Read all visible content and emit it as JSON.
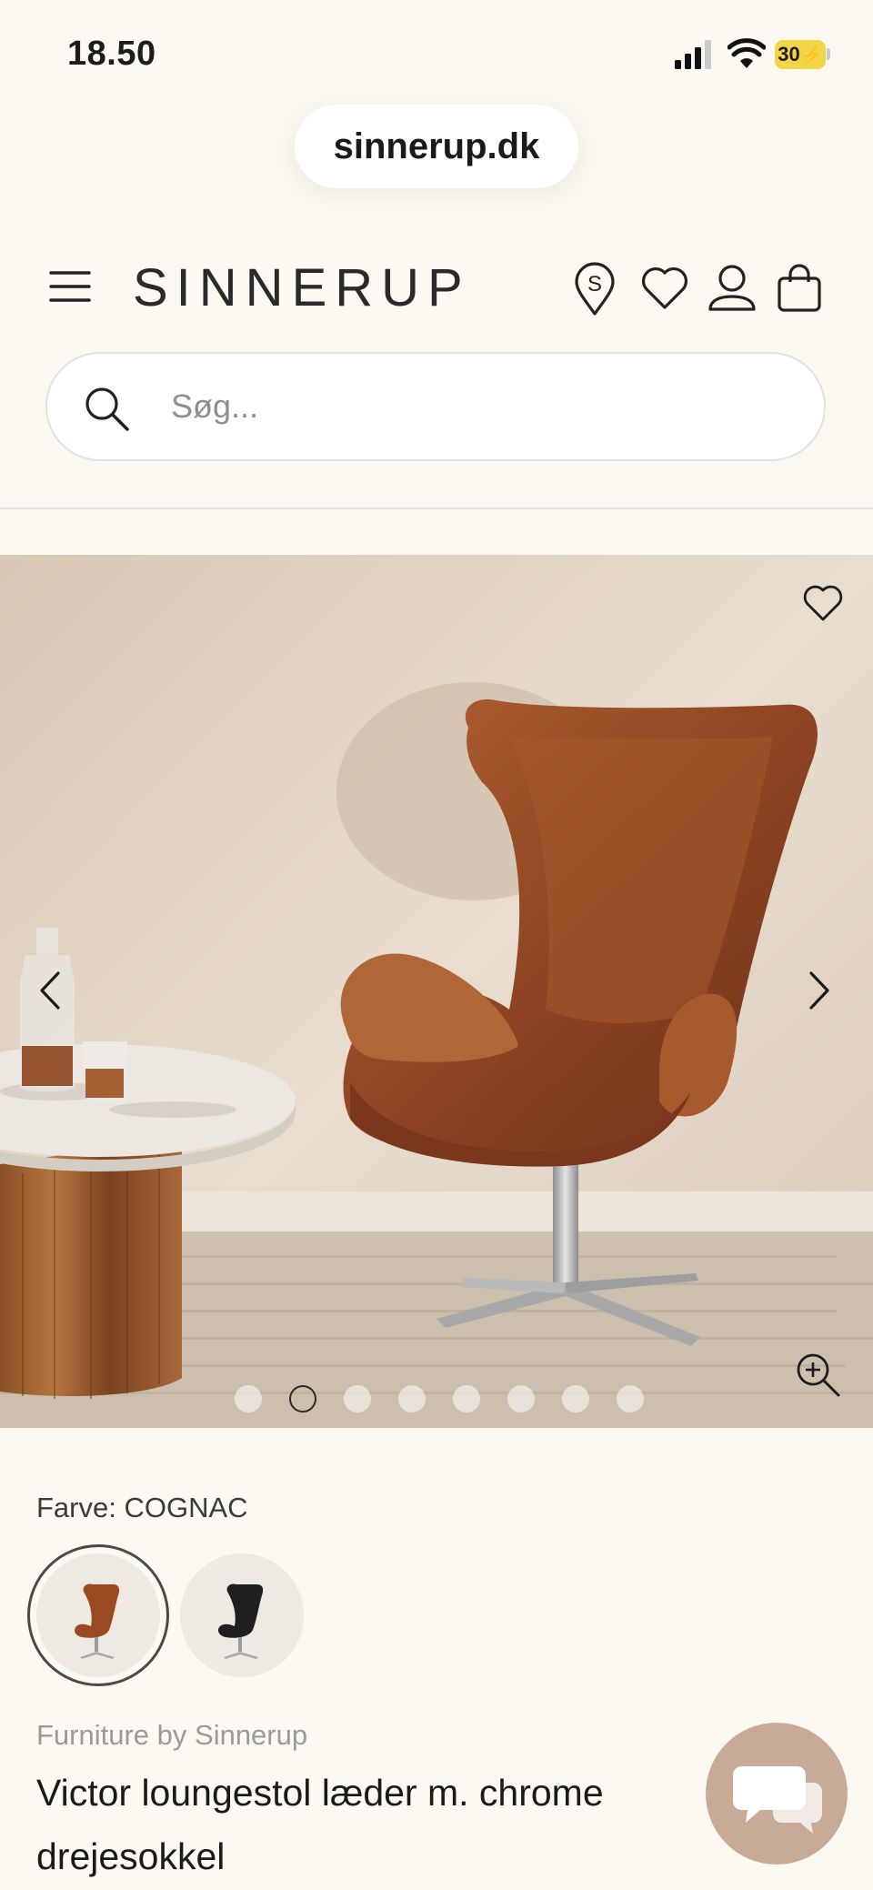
{
  "status_bar": {
    "time": "18.50",
    "battery": "30"
  },
  "browser": {
    "url": "sinnerup.dk"
  },
  "header": {
    "brand": "SINNERUP"
  },
  "search": {
    "placeholder": "Søg..."
  },
  "gallery": {
    "image_count": 8,
    "active_index": 1
  },
  "product": {
    "color_label": "Farve: COGNAC",
    "swatches": [
      "cognac",
      "black"
    ],
    "brand": "Furniture by Sinnerup",
    "title": "Victor loungestol læder m. chrome drejesokkel"
  },
  "colors": {
    "background": "#fcf8f2",
    "chat_button": "#c8ab97",
    "leather": "#9a4f2a"
  }
}
